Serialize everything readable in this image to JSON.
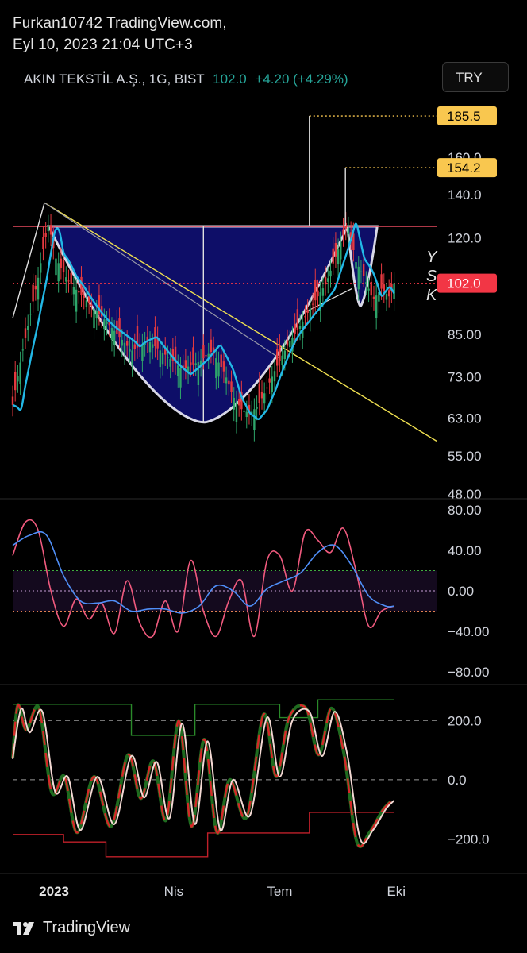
{
  "header": {
    "line1": "Furkan10742 TradingView.com,",
    "line2": "Eyl 10, 2023 21:04 UTC+3"
  },
  "legend": {
    "symbol": "AKIN TEKSTİL A.Ş., 1G, BIST",
    "price": "102.0",
    "change": "+4.20 (+4.29%)"
  },
  "currency_button": "TRY",
  "brand": {
    "name": "TradingView",
    "icon": "tradingview-logo-icon"
  },
  "colors": {
    "accent_up": "#26a69a",
    "price_label": "#f23645",
    "target_label": "#f9c74f",
    "cup_fill": "#10107a",
    "ma": "#22b8e6",
    "trendline": "#f0e050",
    "resistance": "#e84a5f"
  },
  "chart_data": [
    {
      "type": "line",
      "panel": "price",
      "title": "AKIN TEKSTİL A.Ş., 1G, BIST",
      "x_axis_labels": [
        "2023",
        "Nis",
        "Tem",
        "Eki"
      ],
      "y_ticks": [
        48,
        55,
        63,
        73,
        85,
        102,
        120,
        140,
        160
      ],
      "y_tick_labels": [
        "48.00",
        "55.00",
        "63.00",
        "73.00",
        "85.00",
        "",
        "120.0",
        "140.0",
        "160.0"
      ],
      "ylim": [
        48,
        185
      ],
      "y_scale": "log",
      "last_price": 102.0,
      "last_price_label": "102.0",
      "targets": [
        {
          "value": 185.5,
          "label": "185.5"
        },
        {
          "value": 154.2,
          "label": "154.2"
        }
      ],
      "resistance": 125,
      "side_letters": [
        "Y",
        "S",
        "K"
      ],
      "series": [
        {
          "name": "",
          "t": [
            0,
            0.02,
            0.04,
            0.06,
            0.075,
            0.085,
            0.1,
            0.13,
            0.16,
            0.2,
            0.24,
            0.28,
            0.32,
            0.36,
            0.4,
            0.44,
            0.47,
            0.5,
            0.52,
            0.54,
            0.56,
            0.58,
            0.6,
            0.62,
            0.65,
            0.68,
            0.71,
            0.74,
            0.77,
            0.79,
            0.81,
            0.83,
            0.85,
            0.87,
            0.89,
            0.9
          ],
          "close": [
            66,
            78,
            90,
            104,
            118,
            126,
            112,
            103,
            98,
            92,
            86,
            80,
            83,
            79,
            75,
            77,
            80,
            74,
            68,
            65,
            64,
            66,
            70,
            75,
            82,
            88,
            95,
            102,
            116,
            126,
            110,
            104,
            96,
            100,
            97,
            102
          ]
        }
      ]
    },
    {
      "type": "line",
      "panel": "oscillator-1",
      "y_ticks": [
        80,
        40,
        0,
        -40,
        -80
      ],
      "y_tick_labels": [
        "80.00",
        "40.00",
        "0.00",
        "−40.00",
        "−80.00"
      ],
      "ylim": [
        -88,
        88
      ],
      "levels": [
        20,
        0,
        -20
      ],
      "series": [
        {
          "name": "",
          "t": [
            0,
            0.03,
            0.06,
            0.09,
            0.12,
            0.15,
            0.18,
            0.21,
            0.24,
            0.27,
            0.3,
            0.33,
            0.36,
            0.39,
            0.42,
            0.45,
            0.48,
            0.51,
            0.54,
            0.57,
            0.6,
            0.63,
            0.66,
            0.69,
            0.72,
            0.75,
            0.78,
            0.81,
            0.84,
            0.87,
            0.9
          ],
          "values": [
            35,
            68,
            60,
            0,
            -35,
            -8,
            -28,
            -12,
            -42,
            10,
            -32,
            -45,
            -10,
            -40,
            30,
            -20,
            -45,
            -10,
            10,
            -45,
            30,
            35,
            0,
            58,
            50,
            38,
            62,
            20,
            -35,
            -20,
            -15
          ]
        },
        {
          "name": "",
          "t": [
            0,
            0.04,
            0.08,
            0.12,
            0.16,
            0.2,
            0.24,
            0.28,
            0.32,
            0.36,
            0.4,
            0.44,
            0.48,
            0.52,
            0.56,
            0.6,
            0.64,
            0.68,
            0.72,
            0.76,
            0.8,
            0.84,
            0.88,
            0.9
          ],
          "values": [
            45,
            55,
            55,
            15,
            -10,
            -12,
            -10,
            -20,
            -18,
            -18,
            -22,
            -15,
            5,
            0,
            -15,
            2,
            10,
            18,
            38,
            45,
            25,
            -5,
            -15,
            -15
          ]
        }
      ]
    },
    {
      "type": "line",
      "panel": "oscillator-2",
      "y_ticks": [
        200,
        0,
        -200
      ],
      "y_tick_labels": [
        "200.0",
        "0.0",
        "−200.0"
      ],
      "ylim": [
        -290,
        300
      ],
      "levels": [
        200,
        0,
        -200
      ],
      "series": [
        {
          "name": "",
          "t": [
            0,
            0.02,
            0.04,
            0.07,
            0.1,
            0.13,
            0.16,
            0.2,
            0.24,
            0.28,
            0.31,
            0.34,
            0.37,
            0.4,
            0.43,
            0.46,
            0.49,
            0.52,
            0.56,
            0.6,
            0.63,
            0.66,
            0.7,
            0.73,
            0.76,
            0.79,
            0.82,
            0.85,
            0.88,
            0.9
          ],
          "values": [
            70,
            240,
            160,
            230,
            -40,
            10,
            -170,
            10,
            -150,
            80,
            -60,
            60,
            -130,
            190,
            -150,
            130,
            -170,
            0,
            -120,
            210,
            10,
            200,
            230,
            80,
            230,
            80,
            -200,
            -170,
            -100,
            -70
          ]
        }
      ]
    }
  ]
}
